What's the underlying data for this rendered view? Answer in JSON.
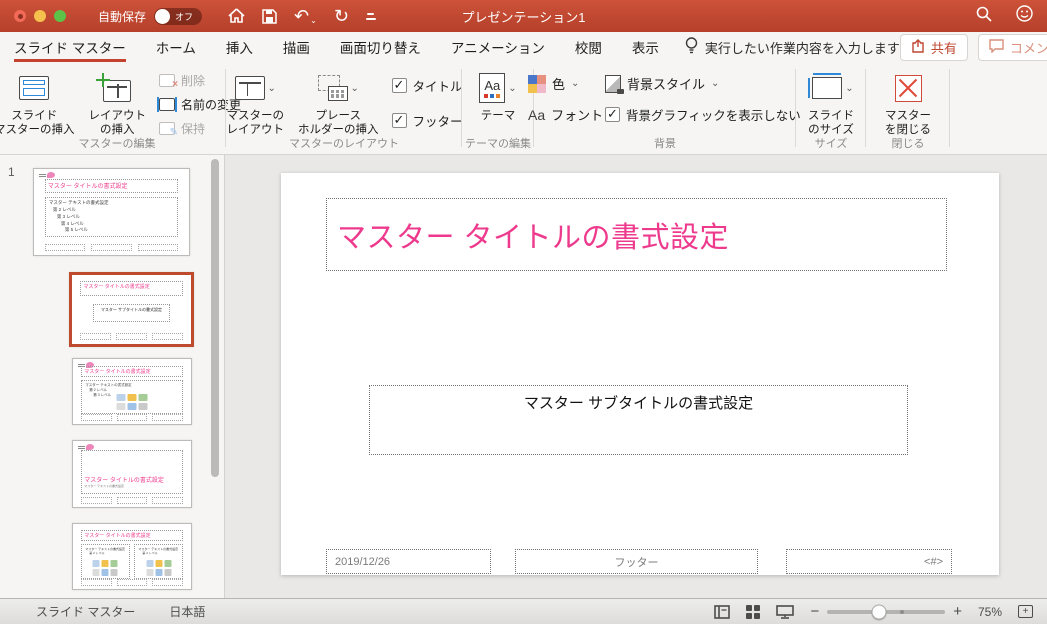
{
  "colors": {
    "accent_red": "#c3432f",
    "title_pink": "#ee3a8d",
    "selected_thumb_border": "#bf4b2e"
  },
  "titlebar": {
    "autosave_label": "自動保存",
    "autosave_state": "オフ",
    "title": "プレゼンテーション1"
  },
  "tabbar": {
    "tabs": [
      {
        "label": "スライド マスター",
        "active": true
      },
      {
        "label": "ホーム"
      },
      {
        "label": "挿入"
      },
      {
        "label": "描画"
      },
      {
        "label": "画面切り替え"
      },
      {
        "label": "アニメーション"
      },
      {
        "label": "校閲"
      },
      {
        "label": "表示"
      }
    ],
    "tell_me": "実行したい作業内容を入力します",
    "share": "共有",
    "comment": "コメント"
  },
  "ribbon": {
    "edit": {
      "label": "マスターの編集",
      "insert_slide_master": [
        "スライド",
        "マスターの挿入"
      ],
      "insert_layout": [
        "レイアウト",
        "の挿入"
      ],
      "delete": "削除",
      "rename": "名前の変更",
      "preserve": "保持"
    },
    "master_layout": {
      "label": "マスターのレイアウト",
      "master_layout_btn": [
        "マスターの",
        "レイアウト"
      ],
      "insert_placeholder": [
        "プレース",
        "ホルダーの挿入"
      ],
      "title_checkbox": "タイトル",
      "title_checked": true,
      "footer_checkbox": "フッター",
      "footer_checked": true
    },
    "theme_edit": {
      "label": "テーマの編集",
      "theme_btn": "テーマ"
    },
    "background": {
      "label": "背景",
      "colors_btn": "色",
      "fonts_btn": "フォント",
      "bg_styles_btn": "背景スタイル",
      "hide_bg_graphics": "背景グラフィックを表示しない",
      "hide_bg_graphics_checked": true
    },
    "size": {
      "label": "サイズ",
      "slide_size_btn": [
        "スライド",
        "のサイズ"
      ]
    },
    "close": {
      "label": "閉じる",
      "close_master_btn": [
        "マスター",
        "を閉じる"
      ]
    }
  },
  "panel": {
    "slide_number": "1",
    "master": {
      "title": "マスター タイトルの書式設定",
      "bullets": [
        "マスター テキストの書式設定",
        "第 2 レベル",
        "第 3 レベル",
        "第 4 レベル",
        "第 5 レベル"
      ]
    },
    "title_layout": {
      "title": "マスター タイトルの書式設定",
      "subtitle": "マスター サブタイトルの書式設定"
    },
    "content_layout": {
      "title": "マスター タイトルの書式設定",
      "bullets": [
        "マスター テキストの書式設定",
        "第 2 レベル",
        "第 3 レベル"
      ]
    },
    "section_layout": {
      "title": "マスター タイトルの書式設定",
      "subtext": "マスター テキストの書式設定"
    },
    "two_content_layout": {
      "title": "マスター タイトルの書式設定",
      "bullets": [
        "マスター テキストの書式設定",
        "第 2 レベル"
      ]
    }
  },
  "slide": {
    "title": "マスター タイトルの書式設定",
    "subtitle": "マスター サブタイトルの書式設定",
    "date": "2019/12/26",
    "footer": "フッター",
    "slide_number": "<#>"
  },
  "statusbar": {
    "view_label": "スライド マスター",
    "language": "日本語",
    "zoom_level": "75%"
  }
}
